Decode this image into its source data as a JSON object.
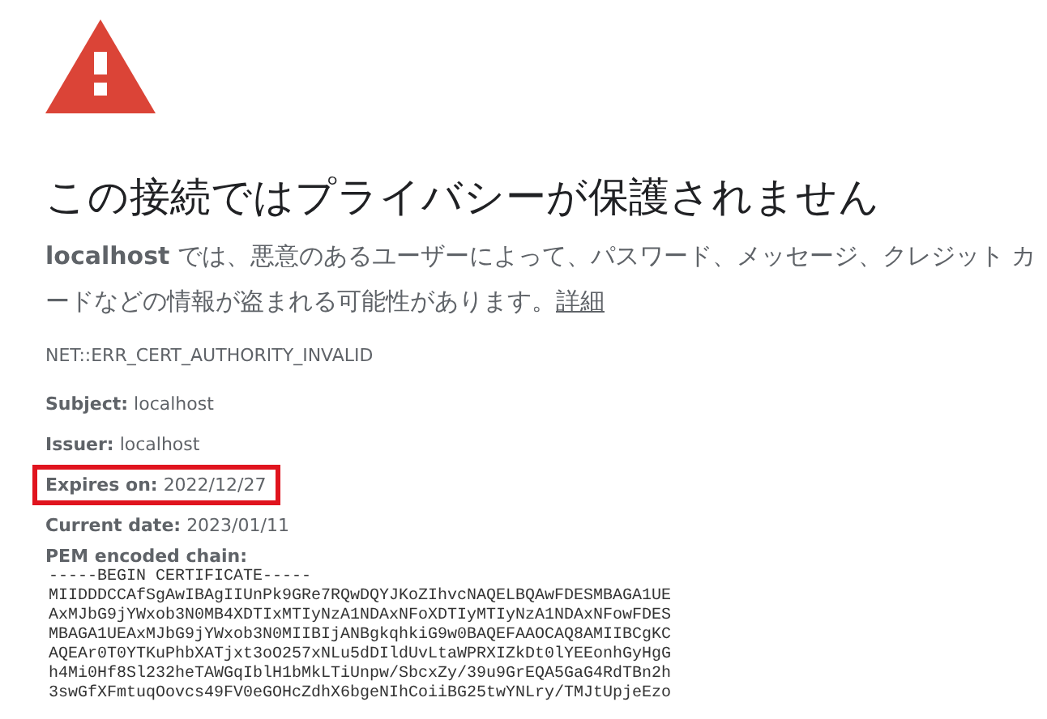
{
  "heading": "この接続ではプライバシーが保護されません",
  "message": {
    "text": "**localhost** では、悪意のあるユーザーによって、パスワード、メッセージ、クレジット カードなどの情報が盗まれる可能性があります。",
    "link": "詳細"
  },
  "error_code": "NET::ERR_CERT_AUTHORITY_INVALID",
  "details": [
    {
      "label": "Subject:",
      "value": "localhost",
      "highlighted": false
    },
    {
      "label": "Issuer:",
      "value": "localhost",
      "highlighted": false
    },
    {
      "label": "Expires on:",
      "value": "2022/12/27",
      "highlighted": true
    },
    {
      "label": "Current date:",
      "value": "2023/01/11",
      "highlighted": false
    }
  ],
  "pem": {
    "label": "PEM encoded chain:",
    "lines": [
      "-----BEGIN CERTIFICATE-----",
      "MIIDDDCCAfSgAwIBAgIIUnPk9GRe7RQwDQYJKoZIhvcNAQELBQAwFDESMBAGA1UE",
      "AxMJbG9jYWxob3N0MB4XDTIxMTIyNzA1NDAxNFoXDTIyMTIyNzA1NDAxNFowFDES",
      "MBAGA1UEAxMJbG9jYWxob3N0MIIBIjANBgkqhkiG9w0BAQEFAAOCAQ8AMIIBCgKC",
      "AQEAr0T0YTKuPhbXATjxt3oO257xNLu5dDIldUvLtaWPRXIZkDt0lYEEonhGyHgG",
      "h4Mi0Hf8Sl232heTAWGqIblH1bMkLTiUnpw/SbcxZy/39u9GrEQA5GaG4RdTBn2h",
      "3swGfXFmtuqOovcs49FV0eGOHcZdhX6bgeNIhCoiiBG25twYNLry/TMJtUpjeEzo"
    ]
  }
}
